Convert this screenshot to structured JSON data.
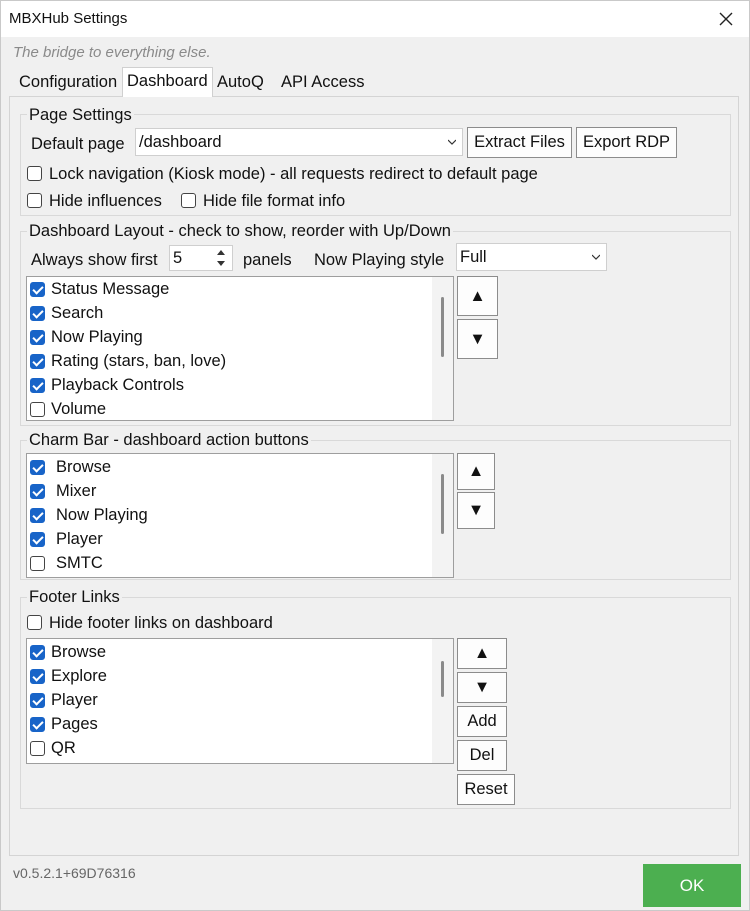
{
  "window": {
    "title": "MBXHub Settings",
    "tagline": "The bridge to everything else."
  },
  "tabs": [
    {
      "label": "Configuration",
      "active": false
    },
    {
      "label": "Dashboard",
      "active": true
    },
    {
      "label": "AutoQ",
      "active": false
    },
    {
      "label": "API Access",
      "active": false
    }
  ],
  "page_settings": {
    "legend": "Page Settings",
    "default_page_label": "Default page",
    "default_page_value": "/dashboard",
    "extract_files": "Extract Files",
    "export_rdp": "Export RDP",
    "lock_navigation": {
      "label": "Lock navigation (Kiosk mode) - all requests redirect to default page",
      "checked": false
    },
    "hide_influences": {
      "label": "Hide influences",
      "checked": false
    },
    "hide_file_format": {
      "label": "Hide file format info",
      "checked": false
    }
  },
  "dashboard_layout": {
    "legend": "Dashboard Layout - check to show, reorder with Up/Down",
    "always_show_label": "Always show first",
    "always_show_value": "5",
    "panels_label": "panels",
    "now_playing_style_label": "Now Playing style",
    "now_playing_style_value": "Full",
    "items": [
      {
        "label": "Status Message",
        "checked": true
      },
      {
        "label": "Search",
        "checked": true
      },
      {
        "label": "Now Playing",
        "checked": true
      },
      {
        "label": "Rating (stars, ban, love)",
        "checked": true
      },
      {
        "label": "Playback Controls",
        "checked": true
      },
      {
        "label": "Volume",
        "checked": false
      }
    ],
    "up": "▲",
    "down": "▼"
  },
  "charm_bar": {
    "legend": "Charm Bar - dashboard action buttons",
    "items": [
      {
        "label": "Browse",
        "checked": true
      },
      {
        "label": "Mixer",
        "checked": true
      },
      {
        "label": "Now Playing",
        "checked": true
      },
      {
        "label": "Player",
        "checked": true
      },
      {
        "label": "SMTC",
        "checked": false
      }
    ],
    "up": "▲",
    "down": "▼"
  },
  "footer_links": {
    "legend": "Footer Links",
    "hide_footer": {
      "label": "Hide footer links on dashboard",
      "checked": false
    },
    "items": [
      {
        "label": "Browse",
        "checked": true
      },
      {
        "label": "Explore",
        "checked": true
      },
      {
        "label": "Player",
        "checked": true
      },
      {
        "label": "Pages",
        "checked": true
      },
      {
        "label": "QR",
        "checked": false
      }
    ],
    "up": "▲",
    "down": "▼",
    "add": "Add",
    "del": "Del",
    "reset": "Reset"
  },
  "footer": {
    "version": "v0.5.2.1+69D76316",
    "ok": "OK"
  },
  "colors": {
    "checkbox_accent": "#1864c8",
    "ok_button": "#4caf50"
  }
}
